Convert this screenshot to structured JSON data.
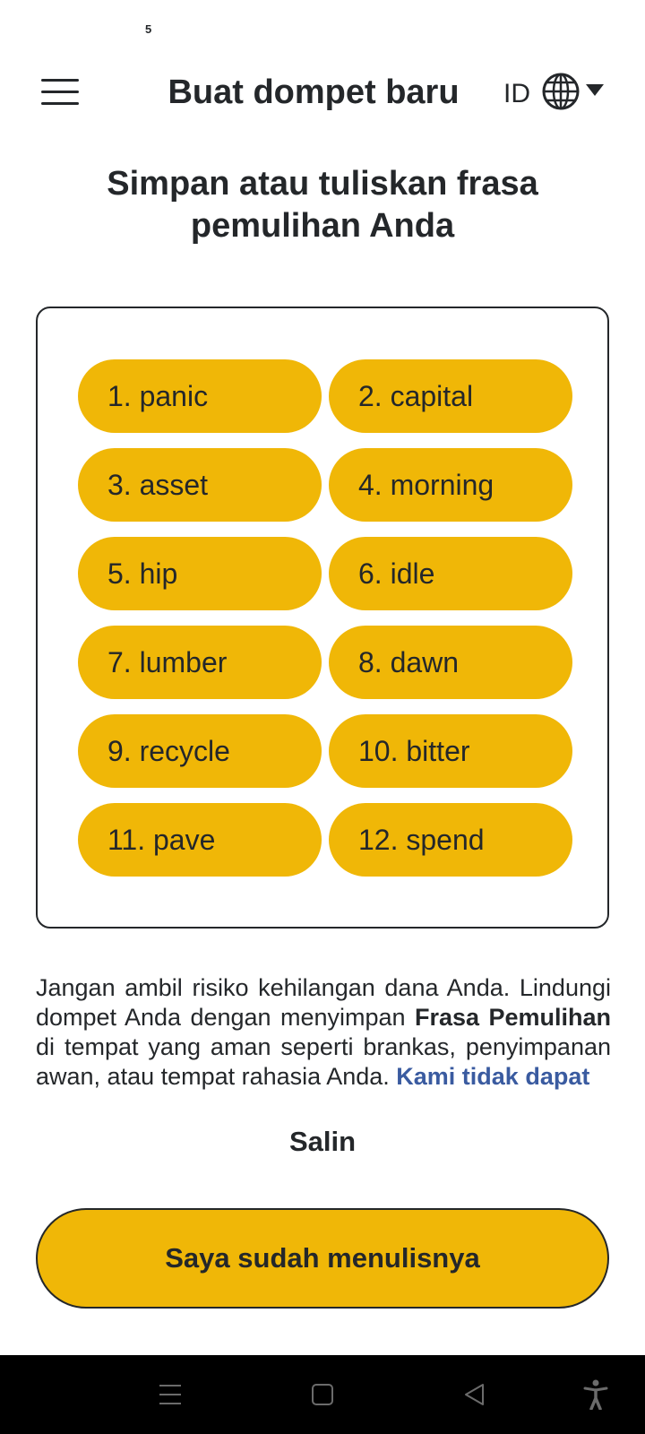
{
  "status_bar": {
    "notification_count": "5"
  },
  "header": {
    "title": "Buat dompet baru",
    "language_code": "ID",
    "menu_icon": "hamburger-menu-icon",
    "globe_icon": "globe-icon",
    "caret_icon": "caret-down-icon"
  },
  "heading": "Simpan atau tuliskan frasa pemulihan Anda",
  "recovery_phrase": [
    "1. panic",
    "2. capital",
    "3. asset",
    "4. morning",
    "5. hip",
    "6. idle",
    "7. lumber",
    "8. dawn",
    "9. recycle",
    "10. bitter",
    "11. pave",
    "12. spend"
  ],
  "info": {
    "text_part1": "Jangan ambil risiko kehilangan dana Anda. Lindungi dompet Anda dengan menyimpan ",
    "bold_text": "Frasa Pemulihan",
    "text_part2": " di tempat yang aman seperti brankas, penyimpanan awan, atau tempat rahasia Anda. ",
    "link_text": "Kami tidak dapat"
  },
  "copy_label": "Salin",
  "primary_button_label": "Saya sudah menulisnya",
  "colors": {
    "accent": "#f0b707",
    "text": "#24272a",
    "link": "#3a5ba0",
    "nav_bar": "#000000"
  },
  "nav_bar": {
    "icons": [
      "recent-apps-icon",
      "home-icon",
      "back-icon",
      "accessibility-icon"
    ]
  }
}
